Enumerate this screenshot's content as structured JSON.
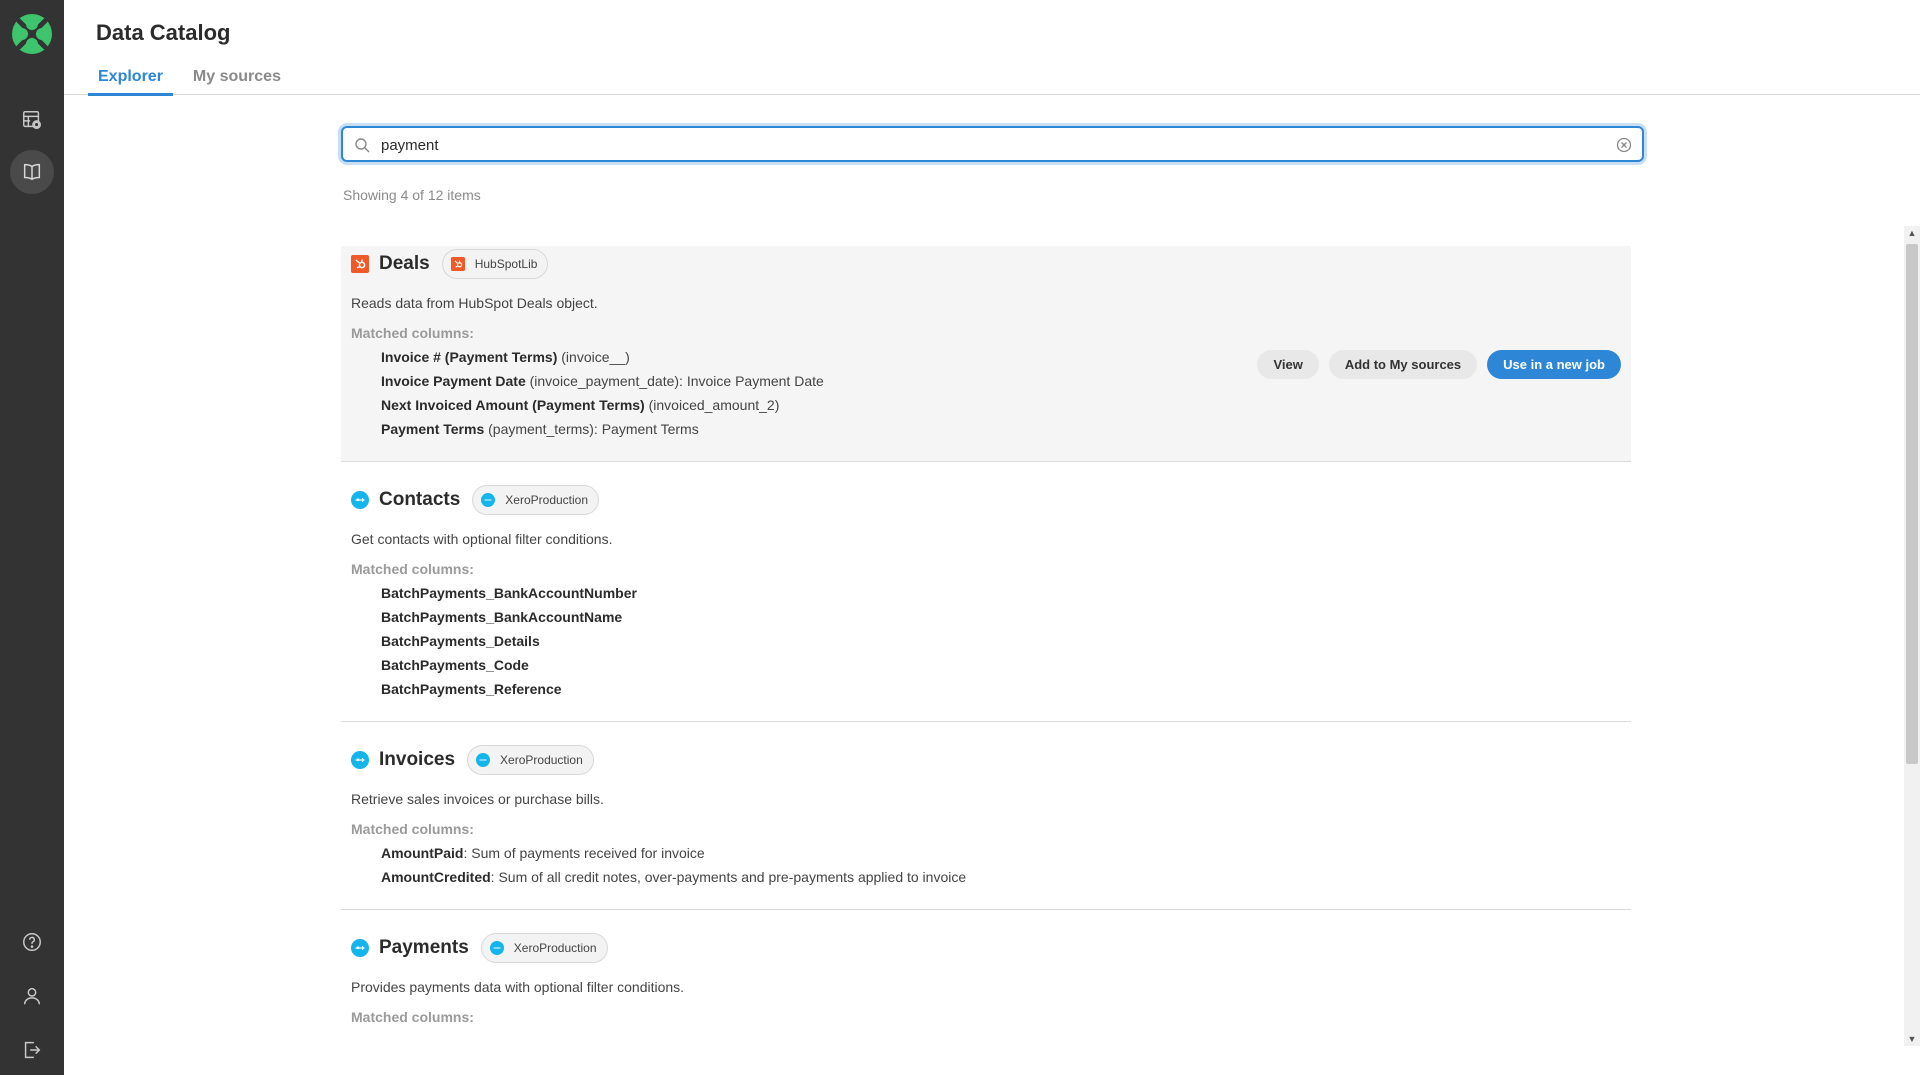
{
  "app": {
    "title": "Data Catalog"
  },
  "sidebar": {
    "items": [
      {
        "icon": "data-grid-icon",
        "active": false
      },
      {
        "icon": "book-icon",
        "active": true
      },
      {
        "icon": "help-icon",
        "active": false
      },
      {
        "icon": "user-icon",
        "active": false
      },
      {
        "icon": "logout-icon",
        "active": false
      }
    ]
  },
  "tabs": [
    {
      "label": "Explorer",
      "active": true
    },
    {
      "label": "My sources",
      "active": false
    }
  ],
  "search": {
    "value": "payment",
    "placeholder": ""
  },
  "results_summary": "Showing 4 of 12 items",
  "colors": {
    "accent": "#2d86d6",
    "sidebar": "#333333",
    "hubspot": "#f05a28",
    "xero": "#13b5ea"
  },
  "results": [
    {
      "title": "Deals",
      "source": "HubSpotLib",
      "source_icon": "hubspot-icon",
      "description": "Reads data from HubSpot Deals object.",
      "matched_label": "Matched columns:",
      "columns": [
        {
          "name": "Invoice # (Payment Terms)",
          "detail": " (invoice__)"
        },
        {
          "name": "Invoice Payment Date",
          "detail": " (invoice_payment_date): Invoice Payment Date"
        },
        {
          "name": "Next Invoiced Amount (Payment Terms)",
          "detail": " (invoiced_amount_2)"
        },
        {
          "name": "Payment Terms",
          "detail": " (payment_terms): Payment Terms"
        }
      ],
      "actions": {
        "view": "View",
        "add": "Add to My sources",
        "use": "Use in a new job"
      }
    },
    {
      "title": "Contacts",
      "source": "XeroProduction",
      "source_icon": "xero-icon",
      "description": "Get contacts with optional filter conditions.",
      "matched_label": "Matched columns:",
      "columns": [
        {
          "name": "BatchPayments_BankAccountNumber",
          "detail": ""
        },
        {
          "name": "BatchPayments_BankAccountName",
          "detail": ""
        },
        {
          "name": "BatchPayments_Details",
          "detail": ""
        },
        {
          "name": "BatchPayments_Code",
          "detail": ""
        },
        {
          "name": "BatchPayments_Reference",
          "detail": ""
        }
      ]
    },
    {
      "title": "Invoices",
      "source": "XeroProduction",
      "source_icon": "xero-icon",
      "description": "Retrieve sales invoices or purchase bills.",
      "matched_label": "Matched columns:",
      "columns": [
        {
          "name": "AmountPaid",
          "detail": ": Sum of payments received for invoice"
        },
        {
          "name": "AmountCredited",
          "detail": ": Sum of all credit notes, over-payments and pre-payments applied to invoice"
        }
      ]
    },
    {
      "title": "Payments",
      "source": "XeroProduction",
      "source_icon": "xero-icon",
      "description": "Provides payments data with optional filter conditions.",
      "matched_label": "Matched columns:",
      "columns": []
    }
  ]
}
